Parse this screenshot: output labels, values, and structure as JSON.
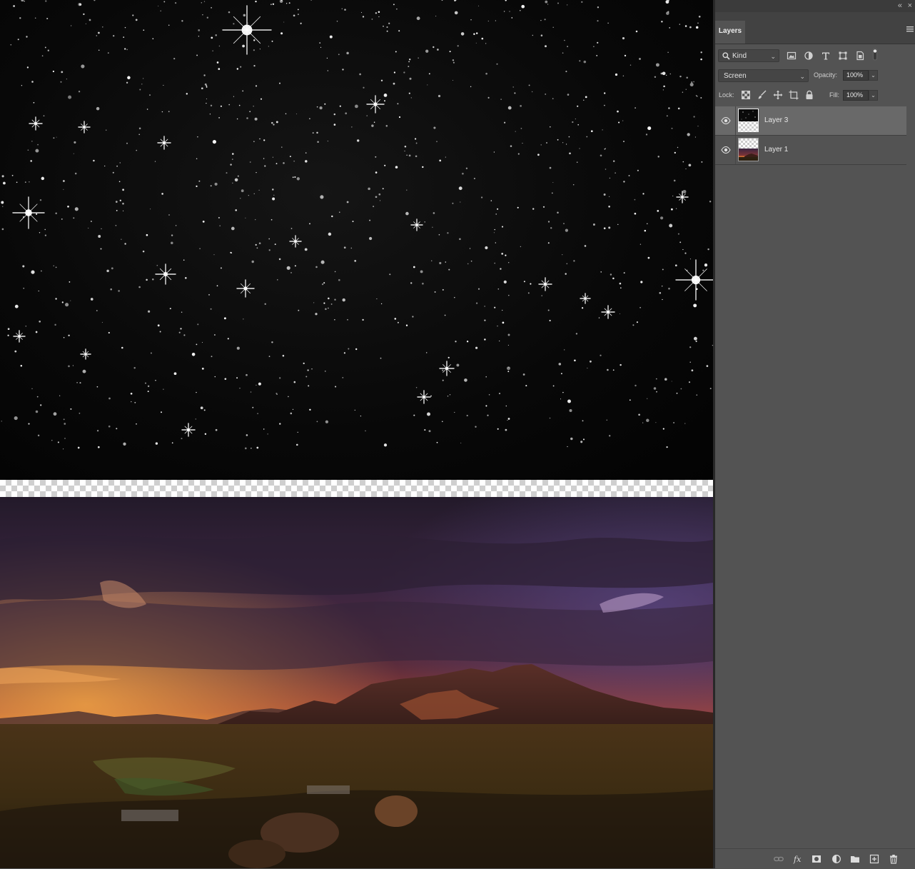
{
  "panel": {
    "tab_label": "Layers",
    "filter": {
      "kind_label": "Kind"
    },
    "blend_mode": "Screen",
    "opacity_label": "Opacity:",
    "opacity_value": "100%",
    "lock_label": "Lock:",
    "fill_label": "Fill:",
    "fill_value": "100%",
    "layers": [
      {
        "name": "Layer 3",
        "visible": true,
        "selected": true,
        "thumbnail": "starfield"
      },
      {
        "name": "Layer 1",
        "visible": true,
        "selected": false,
        "thumbnail": "sunset-landscape"
      }
    ],
    "filter_icons": [
      "pixel-layer-filter-icon",
      "adjustment-layer-filter-icon",
      "type-layer-filter-icon",
      "shape-layer-filter-icon",
      "smart-object-filter-icon",
      "filter-toggle-icon"
    ],
    "lock_icons": [
      "lock-transparent-pixels-icon",
      "lock-image-pixels-icon",
      "lock-position-icon",
      "prevent-autonest-icon",
      "lock-all-icon"
    ],
    "bottom_icons": [
      "link-layers-icon",
      "add-layer-style-icon",
      "add-mask-icon",
      "new-adjustment-layer-icon",
      "new-group-icon",
      "new-layer-icon",
      "delete-layer-icon"
    ]
  },
  "canvas": {
    "top_layer": "starfield",
    "bottom_layer": "sunset-landscape"
  },
  "colors": {
    "panel_bg": "#535353",
    "selected_row": "#696969",
    "sky_purple": "#3a2440",
    "horizon_orange": "#e8762a"
  }
}
